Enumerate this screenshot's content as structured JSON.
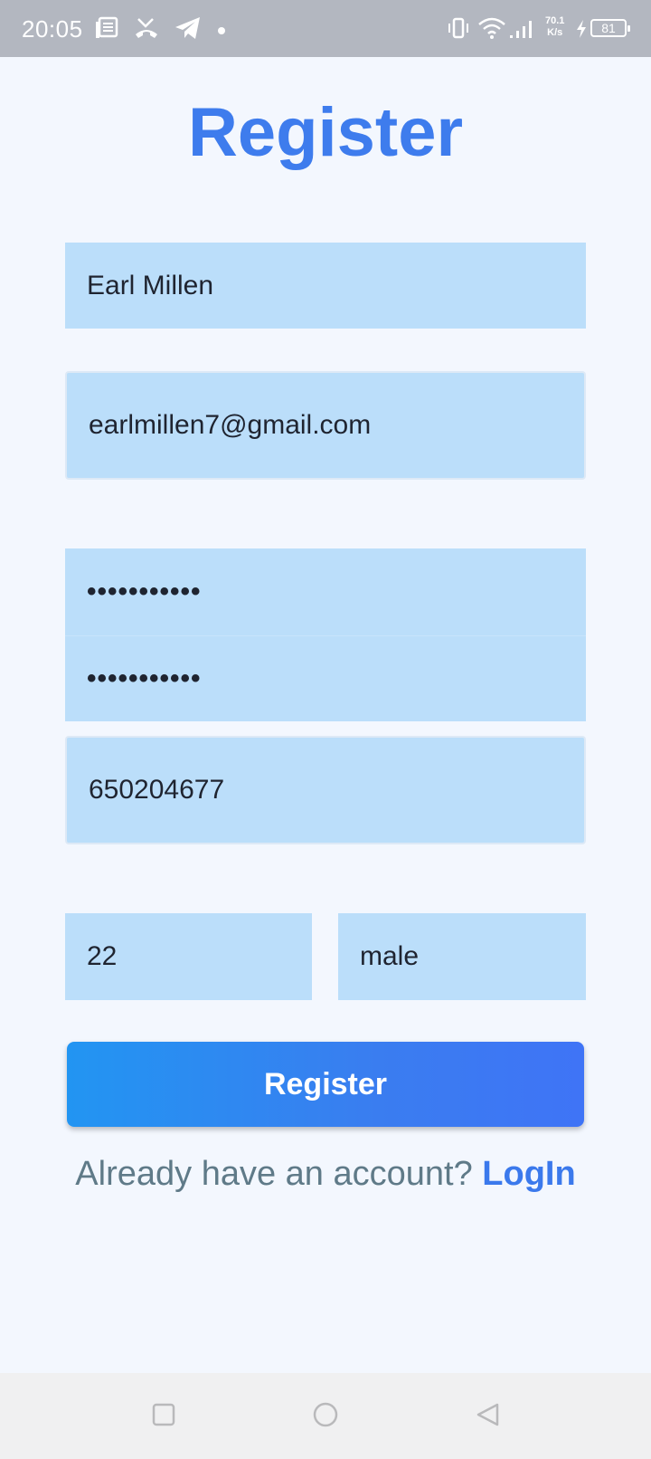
{
  "status_bar": {
    "time": "20:05",
    "network_speed_value": "70.1",
    "network_speed_unit": "K/s",
    "battery_level": "81",
    "icons": [
      "news-icon",
      "missed-call-icon",
      "telegram-icon",
      "dot-icon",
      "vibrate-icon",
      "wifi-icon",
      "signal-icon",
      "charging-icon",
      "battery-icon"
    ]
  },
  "page": {
    "title": "Register"
  },
  "form": {
    "name": "Earl Millen",
    "email": "earlmillen7@gmail.com",
    "password": "•••••••••••",
    "confirm_password": "•••••••••••",
    "phone": "650204677",
    "age": "22",
    "gender": "male"
  },
  "actions": {
    "register_label": "Register",
    "already_account_text": "Already have an account?",
    "login_label": "LogIn"
  },
  "nav_bar": {
    "icons": [
      "recents-icon",
      "home-icon",
      "back-icon"
    ]
  },
  "colors": {
    "accent": "#3e7ced",
    "field_bg": "#bbdefa",
    "page_bg": "#f3f7fe",
    "button_gradient_start": "#2295f2",
    "button_gradient_end": "#3f74f6"
  }
}
